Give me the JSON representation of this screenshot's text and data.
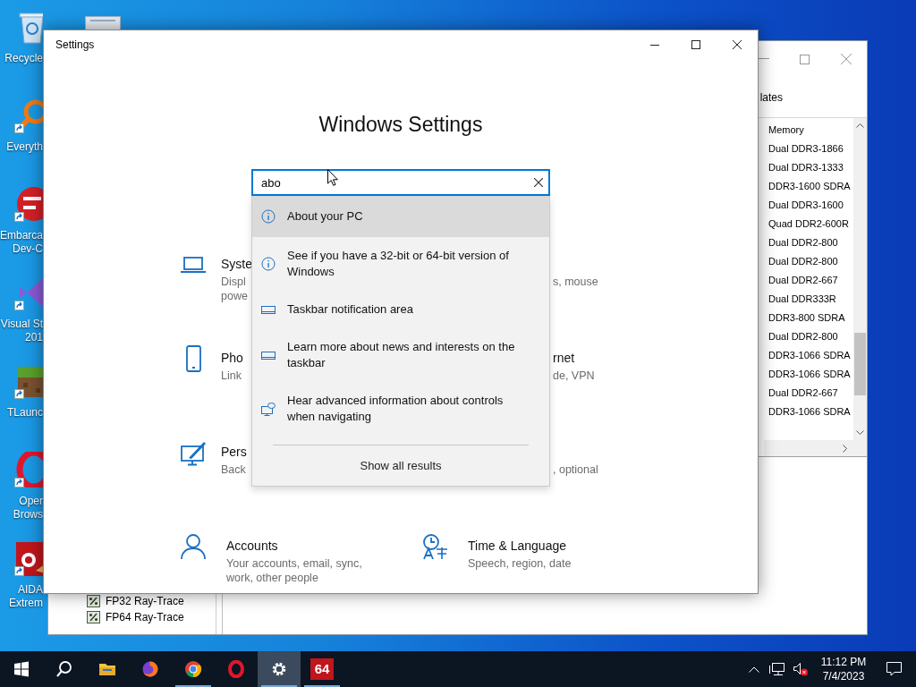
{
  "desktop_icons": [
    {
      "kind": "recycle",
      "shortcut": false,
      "label_lines": [
        "Recycle"
      ]
    },
    {
      "kind": "everything",
      "shortcut": true,
      "label_lines": [
        "Everyth"
      ]
    },
    {
      "kind": "devcpp",
      "shortcut": true,
      "label_lines": [
        "Embarca",
        "Dev-C"
      ]
    },
    {
      "kind": "visualstudio",
      "shortcut": true,
      "label_lines": [
        "Visual St",
        "201"
      ]
    },
    {
      "kind": "tlauncher",
      "shortcut": true,
      "label_lines": [
        "TLaunc"
      ]
    },
    {
      "kind": "opera",
      "shortcut": true,
      "label_lines": [
        "Oper",
        "Brows"
      ]
    },
    {
      "kind": "aida",
      "shortcut": true,
      "label_lines": [
        "AIDA",
        "Extrem"
      ]
    }
  ],
  "background_window": {
    "tab_text": "lates",
    "list": {
      "column": "Memory",
      "rows": [
        "Dual DDR3-1866",
        "Dual DDR3-1333",
        "DDR3-1600 SDRA",
        "Dual DDR3-1600",
        "Quad DDR2-600R",
        "Dual DDR2-800",
        "Dual DDR2-800",
        "Dual DDR2-667",
        "Dual DDR333R",
        "DDR3-800 SDRA",
        "Dual DDR2-800",
        "DDR3-1066 SDRA",
        "DDR3-1066 SDRA",
        "Dual DDR2-667",
        "DDR3-1066 SDRA"
      ]
    },
    "tree_items": [
      "FP32 Ray-Trace",
      "FP64 Ray-Trace"
    ]
  },
  "settings_window": {
    "title": "Settings",
    "heading": "Windows Settings",
    "search": {
      "value": "abo"
    },
    "results": [
      {
        "kind": "info",
        "text": "About your PC",
        "selected": true
      },
      {
        "kind": "info",
        "text": "See if you have a 32-bit or 64-bit version of Windows",
        "selected": false
      },
      {
        "kind": "taskbar",
        "text": "Taskbar notification area",
        "selected": false
      },
      {
        "kind": "taskbar",
        "text": "Learn more about news and interests on the taskbar",
        "selected": false
      },
      {
        "kind": "narrator",
        "text": "Hear advanced information about controls when navigating",
        "selected": false
      }
    ],
    "show_all": "Show all results",
    "categories": [
      {
        "kind": "laptop",
        "title": "Syste",
        "description": [
          "Displ",
          "powe"
        ]
      },
      {
        "kind": "partial",
        "description": [
          "s, mouse"
        ]
      },
      {
        "kind": "phone",
        "title": "Pho",
        "description": [
          "Link"
        ]
      },
      {
        "kind": "partial",
        "title": "rnet",
        "description": [
          "de, VPN"
        ]
      },
      {
        "kind": "paint",
        "title": "Pers",
        "description": [
          "Back"
        ]
      },
      {
        "kind": "partial",
        "description": [
          ", optional"
        ]
      },
      {
        "kind": "person",
        "title": "Accounts",
        "description": [
          "Your accounts, email, sync,",
          "work, other people"
        ]
      },
      {
        "kind": "clock",
        "title": "Time & Language",
        "description": [
          "Speech, region, date"
        ]
      }
    ]
  },
  "taskbar": {
    "apps": [
      {
        "kind": "start",
        "running": false,
        "active": false
      },
      {
        "kind": "search",
        "running": false,
        "active": false
      },
      {
        "kind": "explorer",
        "running": false,
        "active": false
      },
      {
        "kind": "firefox",
        "running": false,
        "active": false
      },
      {
        "kind": "chrome",
        "running": true,
        "active": false
      },
      {
        "kind": "opera",
        "running": false,
        "active": false
      },
      {
        "kind": "settings",
        "running": true,
        "active": true
      },
      {
        "kind": "aida",
        "label": "64",
        "running": true,
        "active": false
      }
    ],
    "clock": {
      "time": "11:12 PM",
      "date": "7/4/2023"
    }
  }
}
